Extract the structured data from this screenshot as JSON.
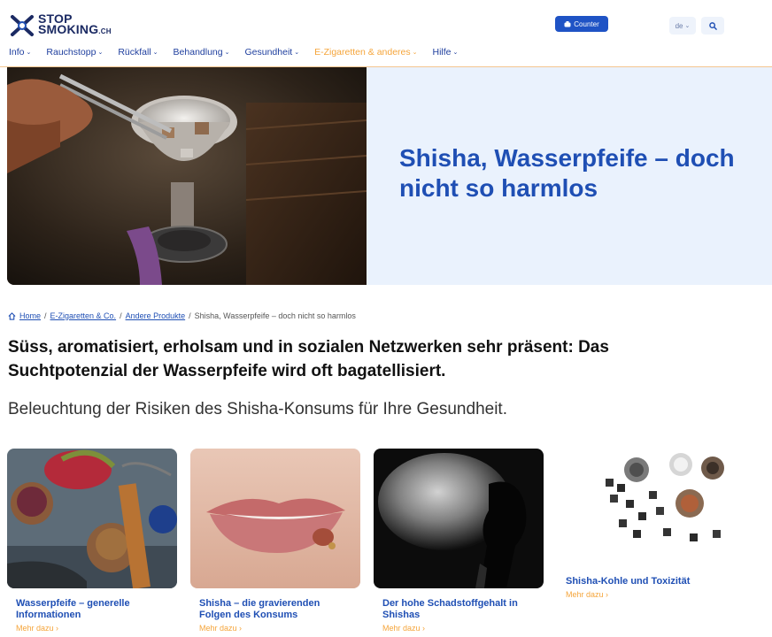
{
  "header": {
    "logo": {
      "line1": "STOP",
      "line2": "SMOKING",
      "suffix": ".CH"
    },
    "counter_label": "Counter",
    "lang_label": "de",
    "nav": [
      {
        "label": "Info"
      },
      {
        "label": "Rauchstopp"
      },
      {
        "label": "Rückfall"
      },
      {
        "label": "Behandlung"
      },
      {
        "label": "Gesundheit"
      },
      {
        "label": "E-Zigaretten & anderes"
      },
      {
        "label": "Hilfe"
      }
    ],
    "active_nav_index": 5
  },
  "hero": {
    "title": "Shisha, Wasserpfeife – doch nicht so harmlos"
  },
  "breadcrumb": {
    "home": "Home",
    "level1": "E-Zigaretten & Co.",
    "level2": "Andere Produkte",
    "current": "Shisha, Wasserpfeife – doch nicht so harmlos"
  },
  "lead": "Süss, aromatisiert, erholsam und in sozialen Netzwerken sehr präsent: Das Suchtpotenzial der Wasserpfeife wird oft bagatellisiert.",
  "subtitle": "Beleuchtung der Risiken des Shisha-Konsums für Ihre Gesundheit.",
  "cards": [
    {
      "title": "Wasserpfeife – generelle Informationen",
      "more": "Mehr dazu"
    },
    {
      "title": "Shisha – die gravierenden Folgen des Konsums",
      "more": "Mehr dazu"
    },
    {
      "title": "Der hohe Schadstoffgehalt in Shishas",
      "more": "Mehr dazu"
    },
    {
      "title": "Shisha-Kohle und Toxizität",
      "more": "Mehr dazu"
    }
  ],
  "colors": {
    "brand_blue": "#1f4fb4",
    "accent_orange": "#f5a53b",
    "hero_bg": "#eaf2fd",
    "logo_navy": "#1b2a63"
  }
}
